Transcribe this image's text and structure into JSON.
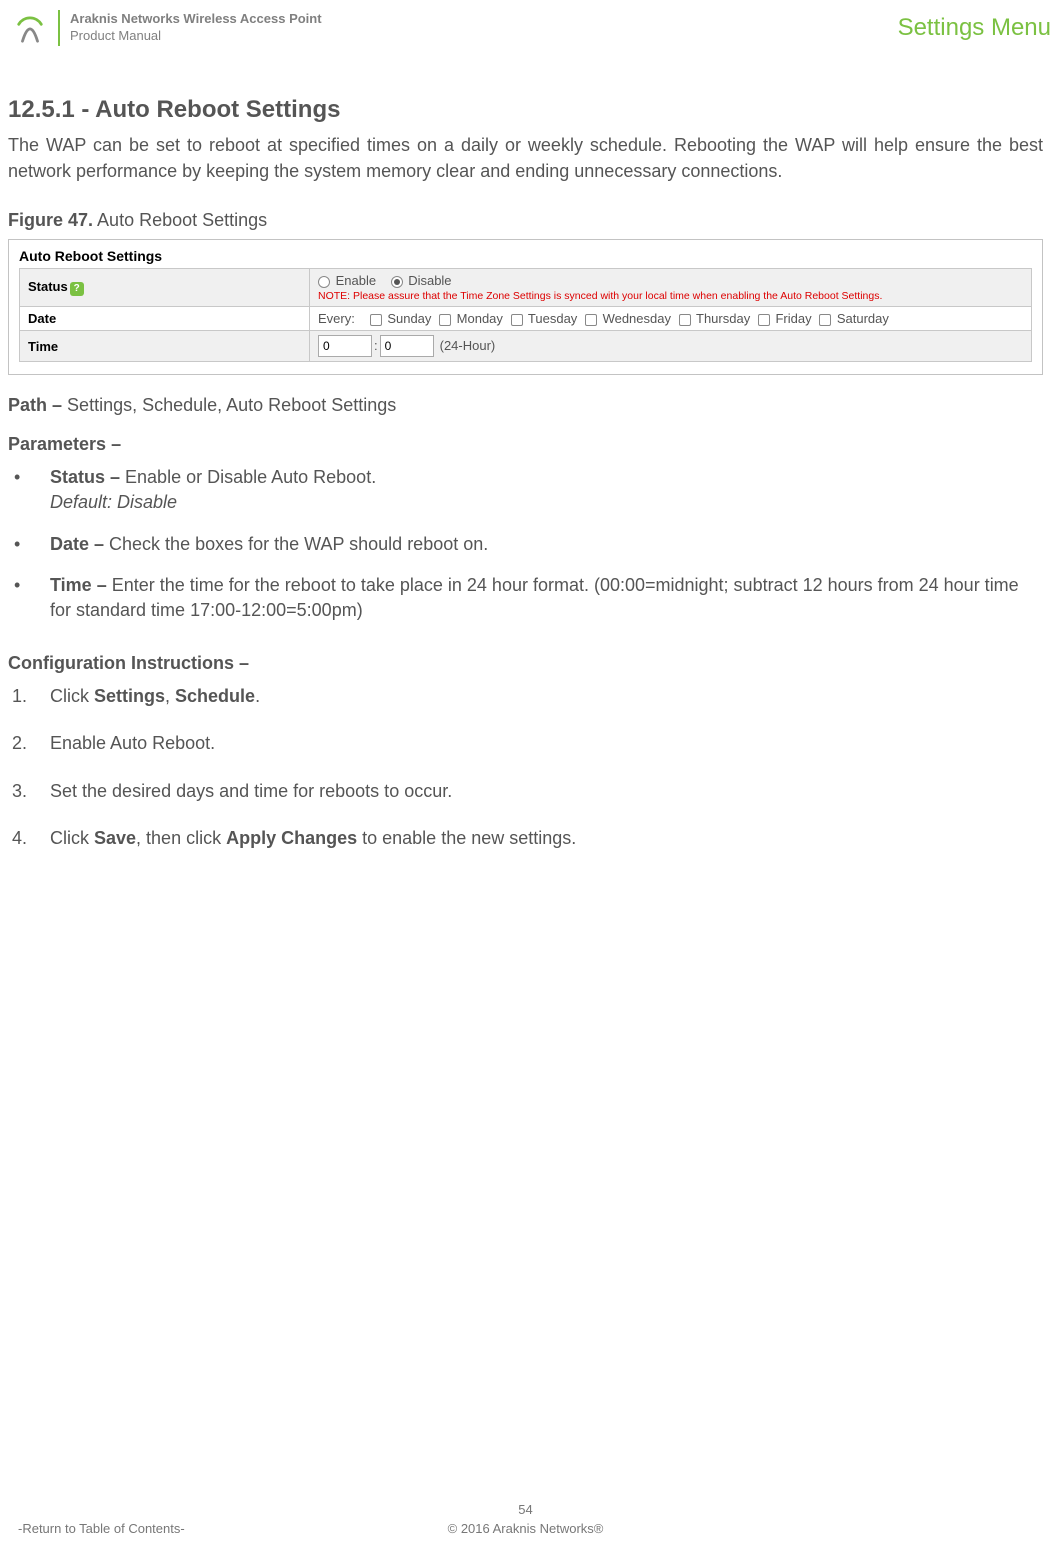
{
  "header": {
    "title": "Araknis Networks Wireless Access Point",
    "subtitle": "Product Manual",
    "menu_label": "Settings Menu"
  },
  "section": {
    "heading": "12.5.1 - Auto Reboot Settings",
    "intro": "The WAP can be set to reboot at specified times on a daily or weekly schedule. Rebooting the WAP will help ensure the best network performance by keeping the system memory clear and ending unnecessary connections."
  },
  "figure": {
    "num": "Figure 47.",
    "caption": "Auto Reboot Settings",
    "panel_title": "Auto Reboot Settings",
    "rows": {
      "status": {
        "label": "Status",
        "enable": "Enable",
        "disable": "Disable",
        "note": "NOTE: Please assure that the Time Zone Settings is synced with your local time when enabling the Auto Reboot Settings."
      },
      "date": {
        "label": "Date",
        "prefix": "Every:",
        "days": [
          "Sunday",
          "Monday",
          "Tuesday",
          "Wednesday",
          "Thursday",
          "Friday",
          "Saturday"
        ]
      },
      "time": {
        "label": "Time",
        "hour": "0",
        "minute": "0",
        "suffix": "(24-Hour)"
      }
    }
  },
  "path": {
    "label": "Path –",
    "value": "Settings, Schedule, Auto Reboot Settings"
  },
  "parameters": {
    "heading": "Parameters –",
    "items": [
      {
        "name": "Status –",
        "desc": " Enable or Disable Auto Reboot.",
        "default": "Default: Disable"
      },
      {
        "name": "Date –",
        "desc": " Check the boxes for the WAP should reboot on."
      },
      {
        "name": "Time –",
        "desc": " Enter the time for the reboot to take place in 24 hour format. (00:00=midnight; subtract 12 hours from 24 hour time for standard time 17:00-12:00=5:00pm)"
      }
    ]
  },
  "config": {
    "heading": "Configuration Instructions –",
    "steps": [
      {
        "pre": "Click ",
        "b1": "Settings",
        "mid": ", ",
        "b2": "Schedule",
        "post": "."
      },
      {
        "plain": "Enable Auto Reboot."
      },
      {
        "plain": "Set the desired days and time for reboots to occur."
      },
      {
        "pre": "Click ",
        "b1": "Save",
        "mid": ", then click ",
        "b2": "Apply Changes",
        "post": " to enable the new settings."
      }
    ]
  },
  "footer": {
    "page": "54",
    "toc": "-Return to Table of Contents-",
    "copyright": "© 2016 Araknis Networks®"
  }
}
